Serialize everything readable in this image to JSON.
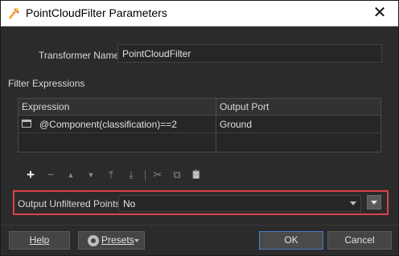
{
  "window": {
    "title": "PointCloudFilter Parameters",
    "close_glyph": "✕",
    "app_icon": "fme-workbench-icon"
  },
  "transformer": {
    "label": "Transformer Name:",
    "value": "PointCloudFilter"
  },
  "filter": {
    "section_label": "Filter Expressions",
    "columns": [
      "Expression",
      "Output Port"
    ],
    "rows": [
      {
        "expression": "@Component(classification)==2",
        "output_port": "Ground"
      }
    ]
  },
  "toolbar": {
    "add": "+",
    "remove": "−",
    "move_up": "▲",
    "move_down": "▼",
    "move_top": "⤒",
    "move_bottom": "⤓",
    "separator": "|",
    "cut": "✂",
    "copy": "⧉",
    "paste": "📋"
  },
  "unfiltered": {
    "label": "Output Unfiltered Points:",
    "value": "No",
    "highlight_color": "#e0404a"
  },
  "buttons": {
    "help": "Help",
    "presets": "Presets",
    "ok": "OK",
    "cancel": "Cancel"
  },
  "colors": {
    "background": "#2b2b2b",
    "primary_border": "#4a7ec8"
  }
}
